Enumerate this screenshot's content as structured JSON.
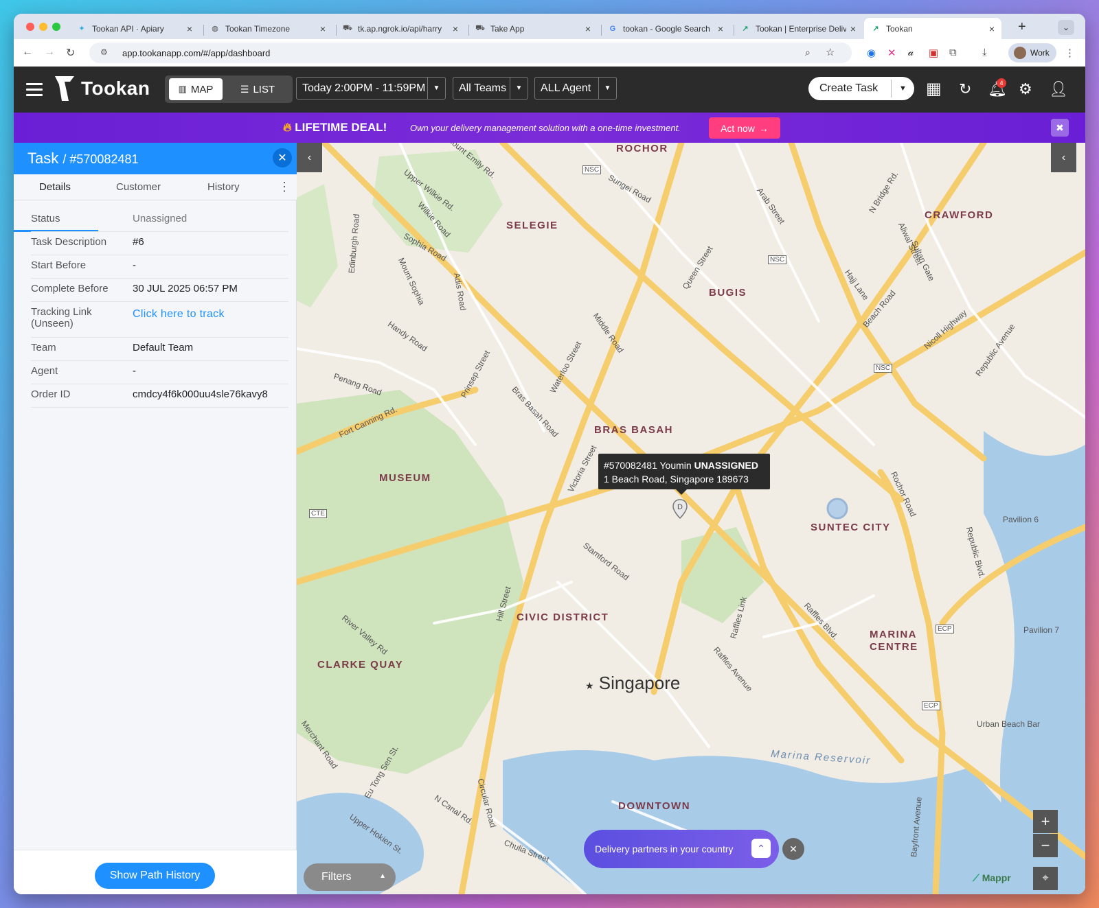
{
  "browser": {
    "tabs": [
      {
        "title": "Tookan API · Apiary",
        "icon": "apiary-icon"
      },
      {
        "title": "Tookan Timezone",
        "icon": "globe-icon"
      },
      {
        "title": "tk.ap.ngrok.io/api/harry",
        "icon": "cart-icon"
      },
      {
        "title": "Take App",
        "icon": "cart-icon"
      },
      {
        "title": "tookan - Google Search",
        "icon": "google-icon"
      },
      {
        "title": "Tookan | Enterprise Delive",
        "icon": "tookan-icon"
      },
      {
        "title": "Tookan",
        "icon": "tookan-icon"
      }
    ],
    "url": "app.tookanapp.com/#/app/dashboard",
    "profile": "Work"
  },
  "header": {
    "logo": "Tookan",
    "map_label": "MAP",
    "list_label": "LIST",
    "time_filter": "Today 2:00PM - 11:59PM",
    "teams_filter": "All Teams",
    "agent_filter": "ALL Agent",
    "create_task": "Create Task",
    "notification_count": "4"
  },
  "banner": {
    "title": "LIFETIME DEAL!",
    "text": "Own your delivery management solution with a one-time investment.",
    "cta": "Act now"
  },
  "task_panel": {
    "title": "Task",
    "task_id": "#570082481",
    "tabs": [
      "Details",
      "Customer",
      "History"
    ],
    "details": [
      {
        "label": "Status",
        "value": "Unassigned"
      },
      {
        "label": "Task Description",
        "value": "#6"
      },
      {
        "label": "Start Before",
        "value": "-"
      },
      {
        "label": "Complete Before",
        "value": "30 JUL 2025 06:57 PM"
      },
      {
        "label": "Tracking Link (Unseen)",
        "value": "Click here to track"
      },
      {
        "label": "Team",
        "value": "Default Team"
      },
      {
        "label": "Agent",
        "value": "-"
      },
      {
        "label": "Order ID",
        "value": "cmdcy4f6k000uu4sle76kavy8"
      }
    ],
    "path_history": "Show Path History"
  },
  "map": {
    "tooltip_line1_id": "#570082481 Youmin",
    "tooltip_status": "UNASSIGNED",
    "tooltip_line2": "1 Beach Road, Singapore 189673",
    "pin_letter": "D",
    "districts": [
      "ROCHOR",
      "SELEGIE",
      "BUGIS",
      "CRAWFORD",
      "BRAS BASAH",
      "MUSEUM",
      "SUNTEC CITY",
      "CIVIC DISTRICT",
      "MARINA",
      "CENTRE",
      "CLARKE QUAY",
      "DOWNTOWN"
    ],
    "city": "Singapore",
    "streets": [
      "Mount Emily Rd.",
      "Upper Wilkie Rd.",
      "Wilkie Road",
      "Sophia Road",
      "Mount Sophia",
      "Adis Road",
      "Edinburgh Road",
      "Handy Road",
      "Penang Road",
      "Fort Canning Rd.",
      "Prinsep Street",
      "Bras Basah Road",
      "Waterloo Street",
      "Middle Road",
      "Queen Street",
      "Victoria Street",
      "Sungei Road",
      "Arab Street",
      "N Bridge Rd.",
      "Aliwal Street",
      "Sultan Gate",
      "Hajj Lane",
      "Beach Road",
      "Nicoll Highway",
      "Republic Avenue",
      "Rochor Road",
      "Stamford Road",
      "Hill Street",
      "River Valley Rd",
      "Raffles Link",
      "Raffles Blvd.",
      "Raffles Avenue",
      "Republic Blvd.",
      "Merchant Road",
      "Eu Tong Sen St.",
      "Circular Road",
      "N Canal Rd.",
      "Upper Hokien St.",
      "Chulia Street",
      "Bayfront Avenue",
      "Marina Reservoir",
      "Pavilion 6",
      "Pavilion 7",
      "Urban Beach Bar",
      "Rochor Road"
    ],
    "badges": [
      "NSC",
      "NSC",
      "NSC",
      "CTE",
      "ECP",
      "ECP"
    ],
    "delivery_prompt": "Delivery partners in your country",
    "filters": "Filters",
    "attribution": "Mappr"
  }
}
